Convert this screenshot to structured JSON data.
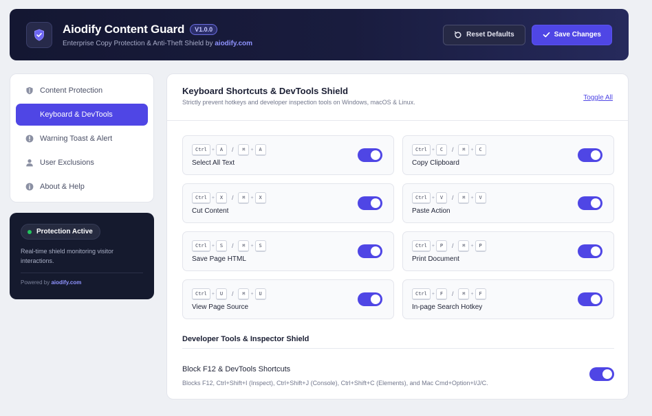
{
  "header": {
    "title": "Aiodify Content Guard",
    "version": "V1.0.0",
    "subtitle_prefix": "Enterprise Copy Protection & Anti-Theft Shield by ",
    "subtitle_link": "aiodify.com",
    "reset_label": "Reset Defaults",
    "save_label": "Save Changes",
    "logo_icon": "shield-check-icon"
  },
  "sidebar": {
    "items": [
      {
        "label": "Content Protection",
        "icon": "shield-icon",
        "active": false
      },
      {
        "label": "Keyboard & DevTools",
        "icon": "",
        "active": true
      },
      {
        "label": "Warning Toast & Alert",
        "icon": "alert-circle-icon",
        "active": false
      },
      {
        "label": "User Exclusions",
        "icon": "user-icon",
        "active": false
      },
      {
        "label": "About & Help",
        "icon": "info-icon",
        "active": false
      }
    ],
    "status": {
      "pill": "Protection Active",
      "text": "Real-time shield monitoring visitor interactions.",
      "powered_prefix": "Powered by ",
      "powered_link": "aiodify.com"
    }
  },
  "main": {
    "title": "Keyboard Shortcuts & DevTools Shield",
    "subtitle": "Strictly prevent hotkeys and developer inspection tools on Windows, macOS & Linux.",
    "toggle_all": "Toggle All",
    "shortcuts": [
      {
        "win": [
          "Ctrl",
          "A"
        ],
        "mac": [
          "⌘",
          "A"
        ],
        "label": "Select All Text",
        "enabled": true
      },
      {
        "win": [
          "Ctrl",
          "C"
        ],
        "mac": [
          "⌘",
          "C"
        ],
        "label": "Copy Clipboard",
        "enabled": true
      },
      {
        "win": [
          "Ctrl",
          "X"
        ],
        "mac": [
          "⌘",
          "X"
        ],
        "label": "Cut Content",
        "enabled": true
      },
      {
        "win": [
          "Ctrl",
          "V"
        ],
        "mac": [
          "⌘",
          "V"
        ],
        "label": "Paste Action",
        "enabled": true
      },
      {
        "win": [
          "Ctrl",
          "S"
        ],
        "mac": [
          "⌘",
          "S"
        ],
        "label": "Save Page HTML",
        "enabled": true
      },
      {
        "win": [
          "Ctrl",
          "P"
        ],
        "mac": [
          "⌘",
          "P"
        ],
        "label": "Print Document",
        "enabled": true
      },
      {
        "win": [
          "Ctrl",
          "U"
        ],
        "mac": [
          "⌘",
          "U"
        ],
        "label": "View Page Source",
        "enabled": true
      },
      {
        "win": [
          "Ctrl",
          "F"
        ],
        "mac": [
          "⌘",
          "F"
        ],
        "label": "In-page Search Hotkey",
        "enabled": true
      }
    ],
    "dev_section_title": "Developer Tools & Inspector Shield",
    "dev": {
      "label": "Block F12 & DevTools Shortcuts",
      "description": "Blocks F12, Ctrl+Shift+I (Inspect), Ctrl+Shift+J (Console), Ctrl+Shift+C (Elements), and Mac Cmd+Option+I/J/C.",
      "enabled": true
    }
  },
  "colors": {
    "accent": "#4f46e5",
    "header_bg": "#141732",
    "status_dot": "#22c55e"
  }
}
